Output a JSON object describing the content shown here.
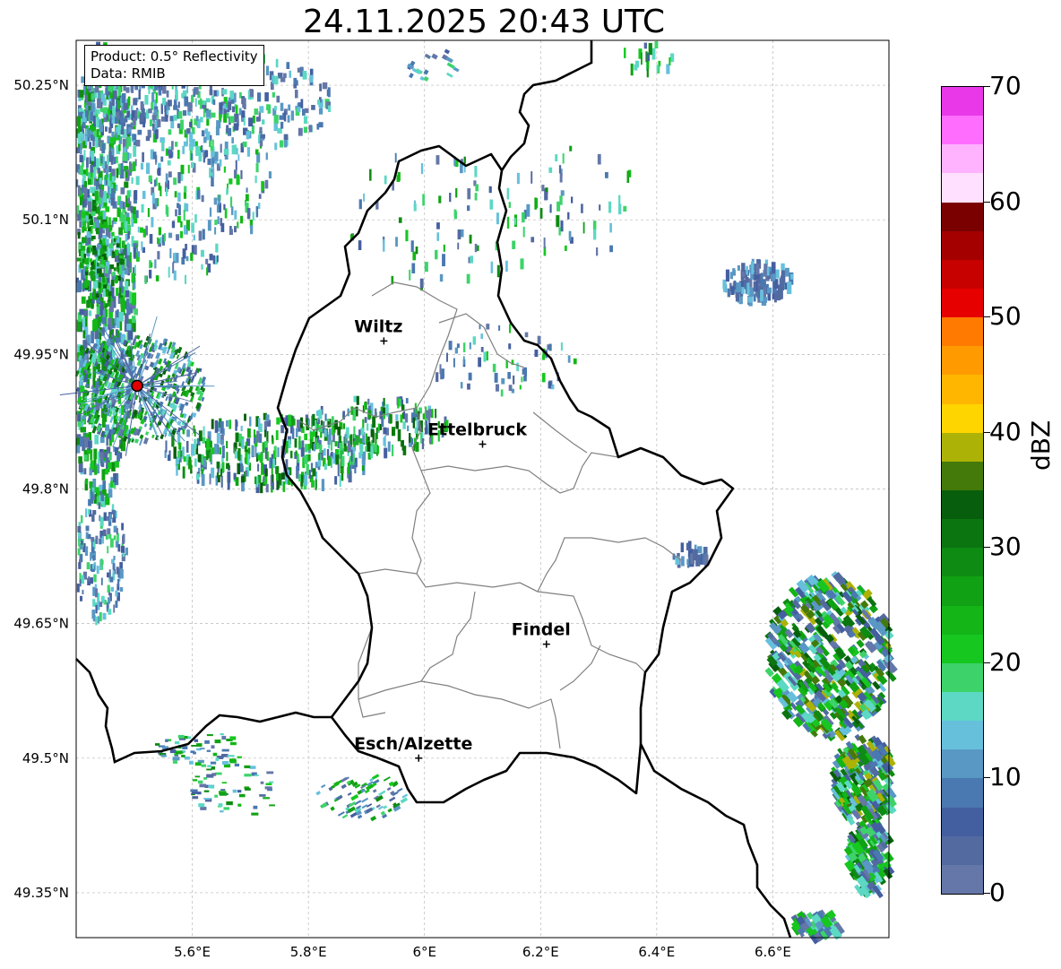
{
  "title": "24.11.2025 20:43 UTC",
  "info_box": {
    "product": "Product: 0.5° Reflectivity",
    "data": "Data: RMIB"
  },
  "axes": {
    "lat_labels": [
      "50.25°N",
      "50.1°N",
      "49.95°N",
      "49.8°N",
      "49.65°N",
      "49.5°N",
      "49.35°N"
    ],
    "lon_labels": [
      "5.6°E",
      "5.8°E",
      "6°E",
      "6.2°E",
      "6.4°E",
      "6.6°E"
    ]
  },
  "cities": [
    {
      "name": "Wiltz",
      "lon": 5.93,
      "lat": 49.965
    },
    {
      "name": "Ettelbruck",
      "lon": 6.1,
      "lat": 49.85
    },
    {
      "name": "Findel",
      "lon": 6.21,
      "lat": 49.627
    },
    {
      "name": "Esch/Alzette",
      "lon": 5.99,
      "lat": 49.5
    }
  ],
  "radar_site": {
    "lon": 5.505,
    "lat": 49.915
  },
  "colorbar": {
    "label": "dBZ",
    "ticks": [
      "0",
      "10",
      "20",
      "30",
      "40",
      "50",
      "60",
      "70"
    ],
    "colors": [
      "#6477a8",
      "#526aa0",
      "#445fa0",
      "#4a78b0",
      "#5998c4",
      "#66c0dc",
      "#5cd8c4",
      "#3dd36a",
      "#16c720",
      "#13b517",
      "#11a114",
      "#0e8b12",
      "#0b7510",
      "#075e0c",
      "#447a0a",
      "#adb206",
      "#ffd500",
      "#ffb600",
      "#ff9b00",
      "#ff7a00",
      "#e60000",
      "#c70000",
      "#a40000",
      "#7a0000",
      "#ffe0ff",
      "#ffb3ff",
      "#ff6dff",
      "#e838e8"
    ]
  },
  "colors": {
    "border": "#000000",
    "canton": "#808080",
    "grid": "#b8b8b8"
  }
}
